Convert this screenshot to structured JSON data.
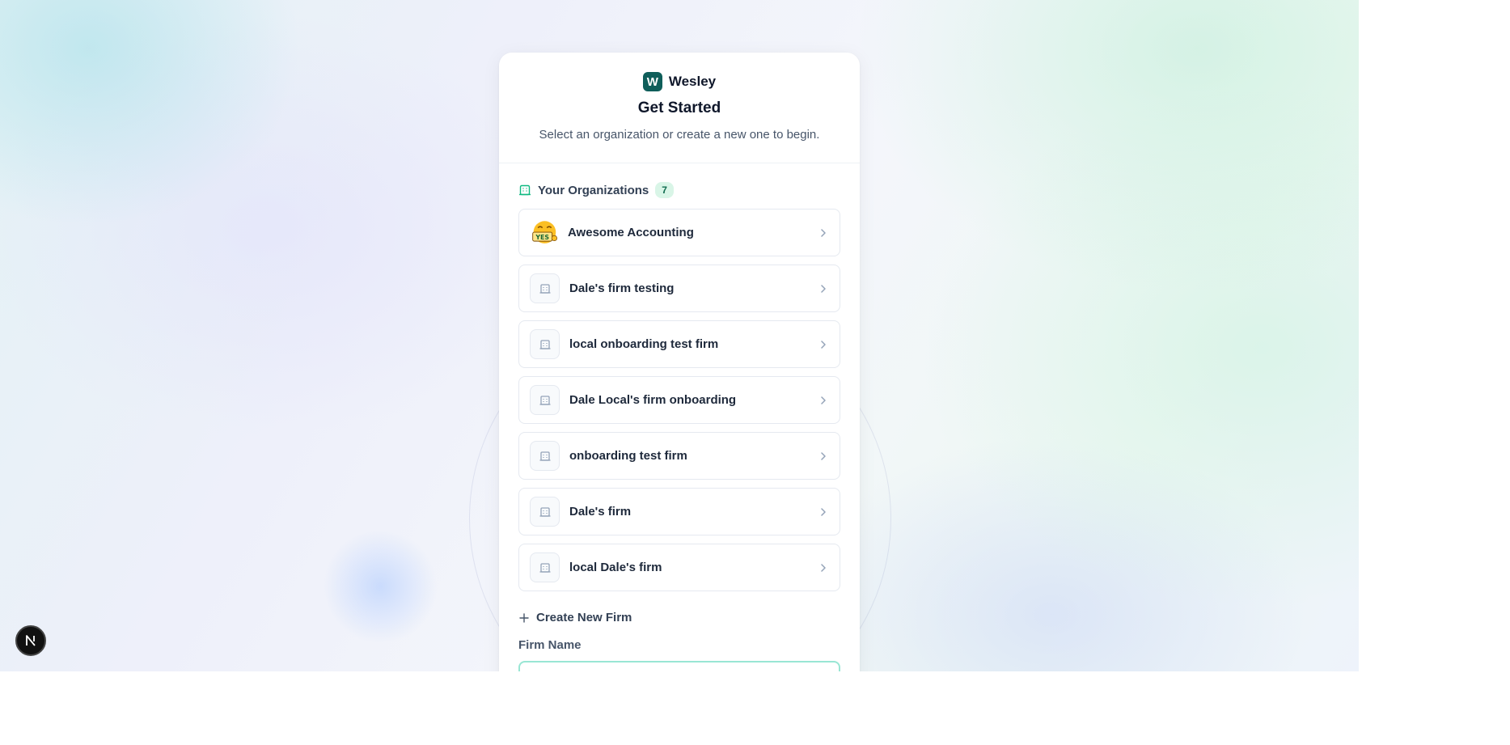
{
  "brand": {
    "logo_letter": "W",
    "name": "Wesley",
    "logo_color": "#0f5e5a"
  },
  "header": {
    "title": "Get Started",
    "subtitle": "Select an organization or create a new one to begin."
  },
  "organizations": {
    "section_title": "Your Organizations",
    "count": "7",
    "items": [
      {
        "name": "Awesome Accounting",
        "icon": "yes-emoji-avatar"
      },
      {
        "name": "Dale's firm testing",
        "icon": "building-icon"
      },
      {
        "name": "local onboarding test firm",
        "icon": "building-icon"
      },
      {
        "name": "Dale Local's firm onboarding",
        "icon": "building-icon"
      },
      {
        "name": "onboarding test firm",
        "icon": "building-icon"
      },
      {
        "name": "Dale's firm",
        "icon": "building-icon"
      },
      {
        "name": "local Dale's firm",
        "icon": "building-icon"
      }
    ]
  },
  "create": {
    "label": "Create New Firm",
    "field_label": "Firm Name",
    "field_value": ""
  },
  "dev_badge": {
    "letter": "N"
  },
  "colors": {
    "accent": "#10b981",
    "input_focus": "#99e6d4",
    "badge_bg": "#d9f5e7"
  }
}
